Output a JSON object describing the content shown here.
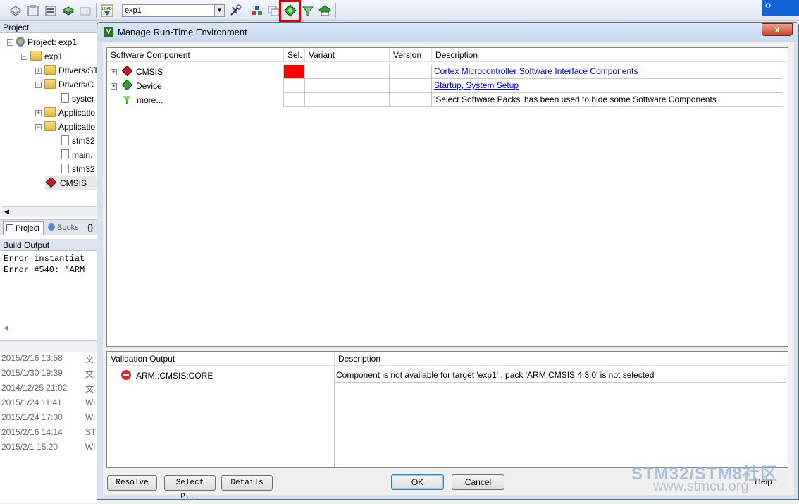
{
  "toolbar": {
    "target": "exp1",
    "icons": [
      "translate-icon",
      "build-icon",
      "rebuild-icon",
      "batch-build-icon",
      "stop-build-icon",
      "download-icon",
      "target-options-icon",
      "file-extensions-icon",
      "manage-multi-project-icon",
      "manage-rte-icon",
      "select-packs-icon",
      "pack-installer-icon"
    ]
  },
  "project_panel": {
    "title": "Project",
    "tree": [
      {
        "label": "Project: exp1",
        "kind": "project"
      },
      {
        "label": "exp1",
        "kind": "target"
      },
      {
        "label": "Drivers/ST",
        "kind": "folder"
      },
      {
        "label": "Drivers/C",
        "kind": "folder"
      },
      {
        "label": "syster",
        "kind": "file"
      },
      {
        "label": "Applicatio",
        "kind": "folder"
      },
      {
        "label": "Applicatio",
        "kind": "folder"
      },
      {
        "label": "stm32",
        "kind": "file"
      },
      {
        "label": "main.",
        "kind": "file"
      },
      {
        "label": "stm32",
        "kind": "file"
      },
      {
        "label": "CMSIS",
        "kind": "component"
      }
    ],
    "tabs": [
      "Project",
      "Books",
      "{}"
    ]
  },
  "build_output": {
    "title": "Build Output",
    "lines": [
      "Error instantiat",
      "Error #540: 'ARM"
    ]
  },
  "history": [
    {
      "date": "2015/2/16 13:58",
      "x": "文"
    },
    {
      "date": "2015/1/30 19:39",
      "x": "文"
    },
    {
      "date": "2014/12/25 21:02",
      "x": "文"
    },
    {
      "date": "2015/1/24 11:41",
      "x": "Wi"
    },
    {
      "date": "2015/1/24 17:00",
      "x": "Wi"
    },
    {
      "date": "2015/2/16 14:14",
      "x": "ST"
    },
    {
      "date": "2015/2/1 15:20",
      "x": "Wi"
    }
  ],
  "dialog": {
    "title": "Manage Run-Time Environment",
    "close": "x",
    "components_table": {
      "headers": [
        "Software Component",
        "Sel.",
        "Variant",
        "Version",
        "Description"
      ],
      "rows": [
        {
          "name": "CMSIS",
          "icon": "red-diamond-icon",
          "sel_state": "error",
          "variant": "",
          "version": "",
          "description": "Cortex Microcontroller Software Interface Components",
          "desc_link": true
        },
        {
          "name": "Device",
          "icon": "green-diamond-icon",
          "sel_state": "none",
          "variant": "",
          "version": "",
          "description": "Startup, System Setup",
          "desc_link": true
        },
        {
          "name": "more...",
          "icon": "pack-filter-icon",
          "sel_state": "none",
          "variant": "",
          "version": "",
          "description": "'Select Software Packs' has been used to hide some Software Components",
          "desc_link": false
        }
      ],
      "colors": {
        "error_fill": "#ff0000"
      }
    },
    "validation_table": {
      "headers": [
        "Validation Output",
        "Description"
      ],
      "rows": [
        {
          "name": "ARM::CMSIS:CORE",
          "icon": "error-stop-icon",
          "description": "Component is not available for target 'exp1' , pack 'ARM.CMSIS.4.3.0' is not selected"
        }
      ]
    },
    "buttons": {
      "resolve": "Resolve",
      "select_packs": "Select P...",
      "details": "Details",
      "ok": "OK",
      "cancel": "Cancel",
      "help": "Help"
    }
  },
  "watermark": {
    "line1": "STM32/STM8社区",
    "line2": "www.stmcu.org"
  }
}
